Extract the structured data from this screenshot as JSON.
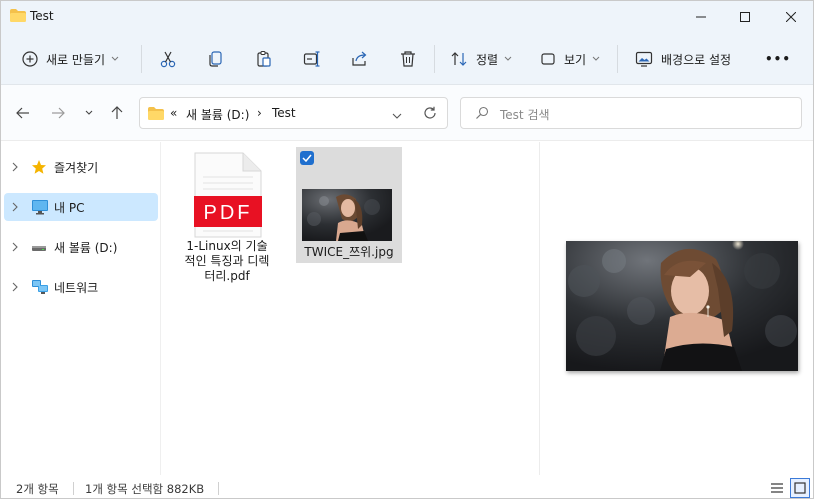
{
  "window": {
    "title": "Test",
    "folder_color": "#f4c14b"
  },
  "toolbar": {
    "new_label": "새로 만들기",
    "sort_label": "정렬",
    "view_label": "보기",
    "wallpaper_label": "배경으로 설정",
    "more_label": "•••"
  },
  "address": {
    "overflow": "«",
    "crumbs": [
      "새 볼륨 (D:)",
      "Test"
    ],
    "separator": "›"
  },
  "search": {
    "placeholder": "Test 검색"
  },
  "sidebar": {
    "items": [
      {
        "label": "즐겨찾기",
        "icon": "star-icon"
      },
      {
        "label": "내 PC",
        "icon": "pc-icon"
      },
      {
        "label": "새 볼륨 (D:)",
        "icon": "drive-icon"
      },
      {
        "label": "네트워크",
        "icon": "network-icon"
      }
    ],
    "selected_index": 1
  },
  "files": [
    {
      "name_lines": [
        "1-Linux의 기술",
        "적인 특징과 디렉",
        "터리.pdf"
      ],
      "type": "pdf",
      "badge": "PDF",
      "badge_color": "#e81123"
    },
    {
      "name_lines": [
        "TWICE_쯔위.jpg"
      ],
      "type": "image",
      "selected": true
    }
  ],
  "status": {
    "item_count": "2개 항목",
    "selection": "1개 항목 선택함 882KB"
  },
  "colors": {
    "accent": "#1f6fce",
    "selection": "#cce8ff"
  }
}
